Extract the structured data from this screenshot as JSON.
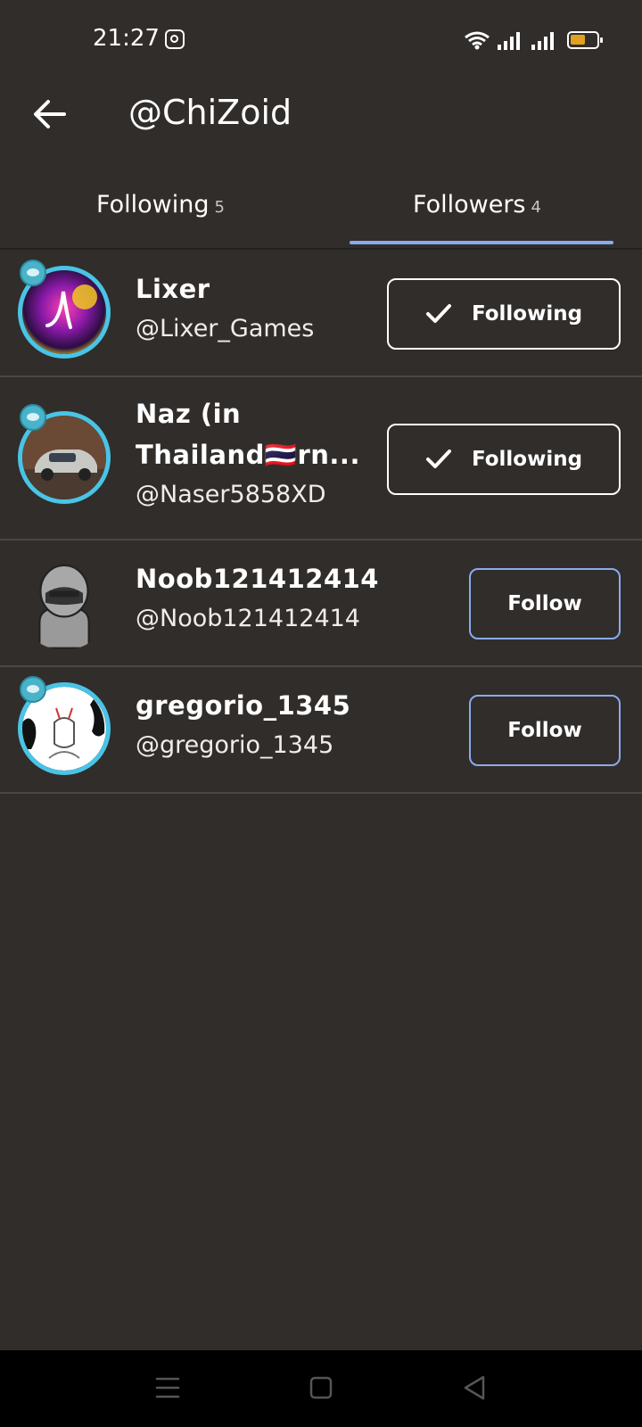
{
  "status_bar": {
    "time": "21:27",
    "icons": [
      "instagram-icon",
      "wifi-icon",
      "signal-icon",
      "signal-icon",
      "battery-icon"
    ],
    "battery_color": "#e0a020"
  },
  "header": {
    "back_icon": "arrow-left-icon",
    "title": "@ChiZoid"
  },
  "tabs": [
    {
      "label": "Following",
      "count": "5",
      "active": false
    },
    {
      "label": "Followers",
      "count": "4",
      "active": true
    }
  ],
  "accent_color": "#8aaaf0",
  "followers": [
    {
      "name": "Lixer",
      "handle": "@Lixer_Games",
      "button": "Following",
      "button_icon": "check-icon"
    },
    {
      "name_line1": "Naz (in",
      "name_line2": "Thailand🇹🇭rn...",
      "handle": "@Naser5858XD",
      "button": "Following",
      "button_icon": "check-icon"
    },
    {
      "name": "Noob121412414",
      "handle": "@Noob121412414",
      "button": "Follow"
    },
    {
      "name": "gregorio_1345",
      "handle": "@gregorio_1345",
      "button": "Follow"
    }
  ],
  "nav_bar": {
    "icons": [
      "menu-icon",
      "home-square-icon",
      "back-triangle-icon"
    ]
  }
}
